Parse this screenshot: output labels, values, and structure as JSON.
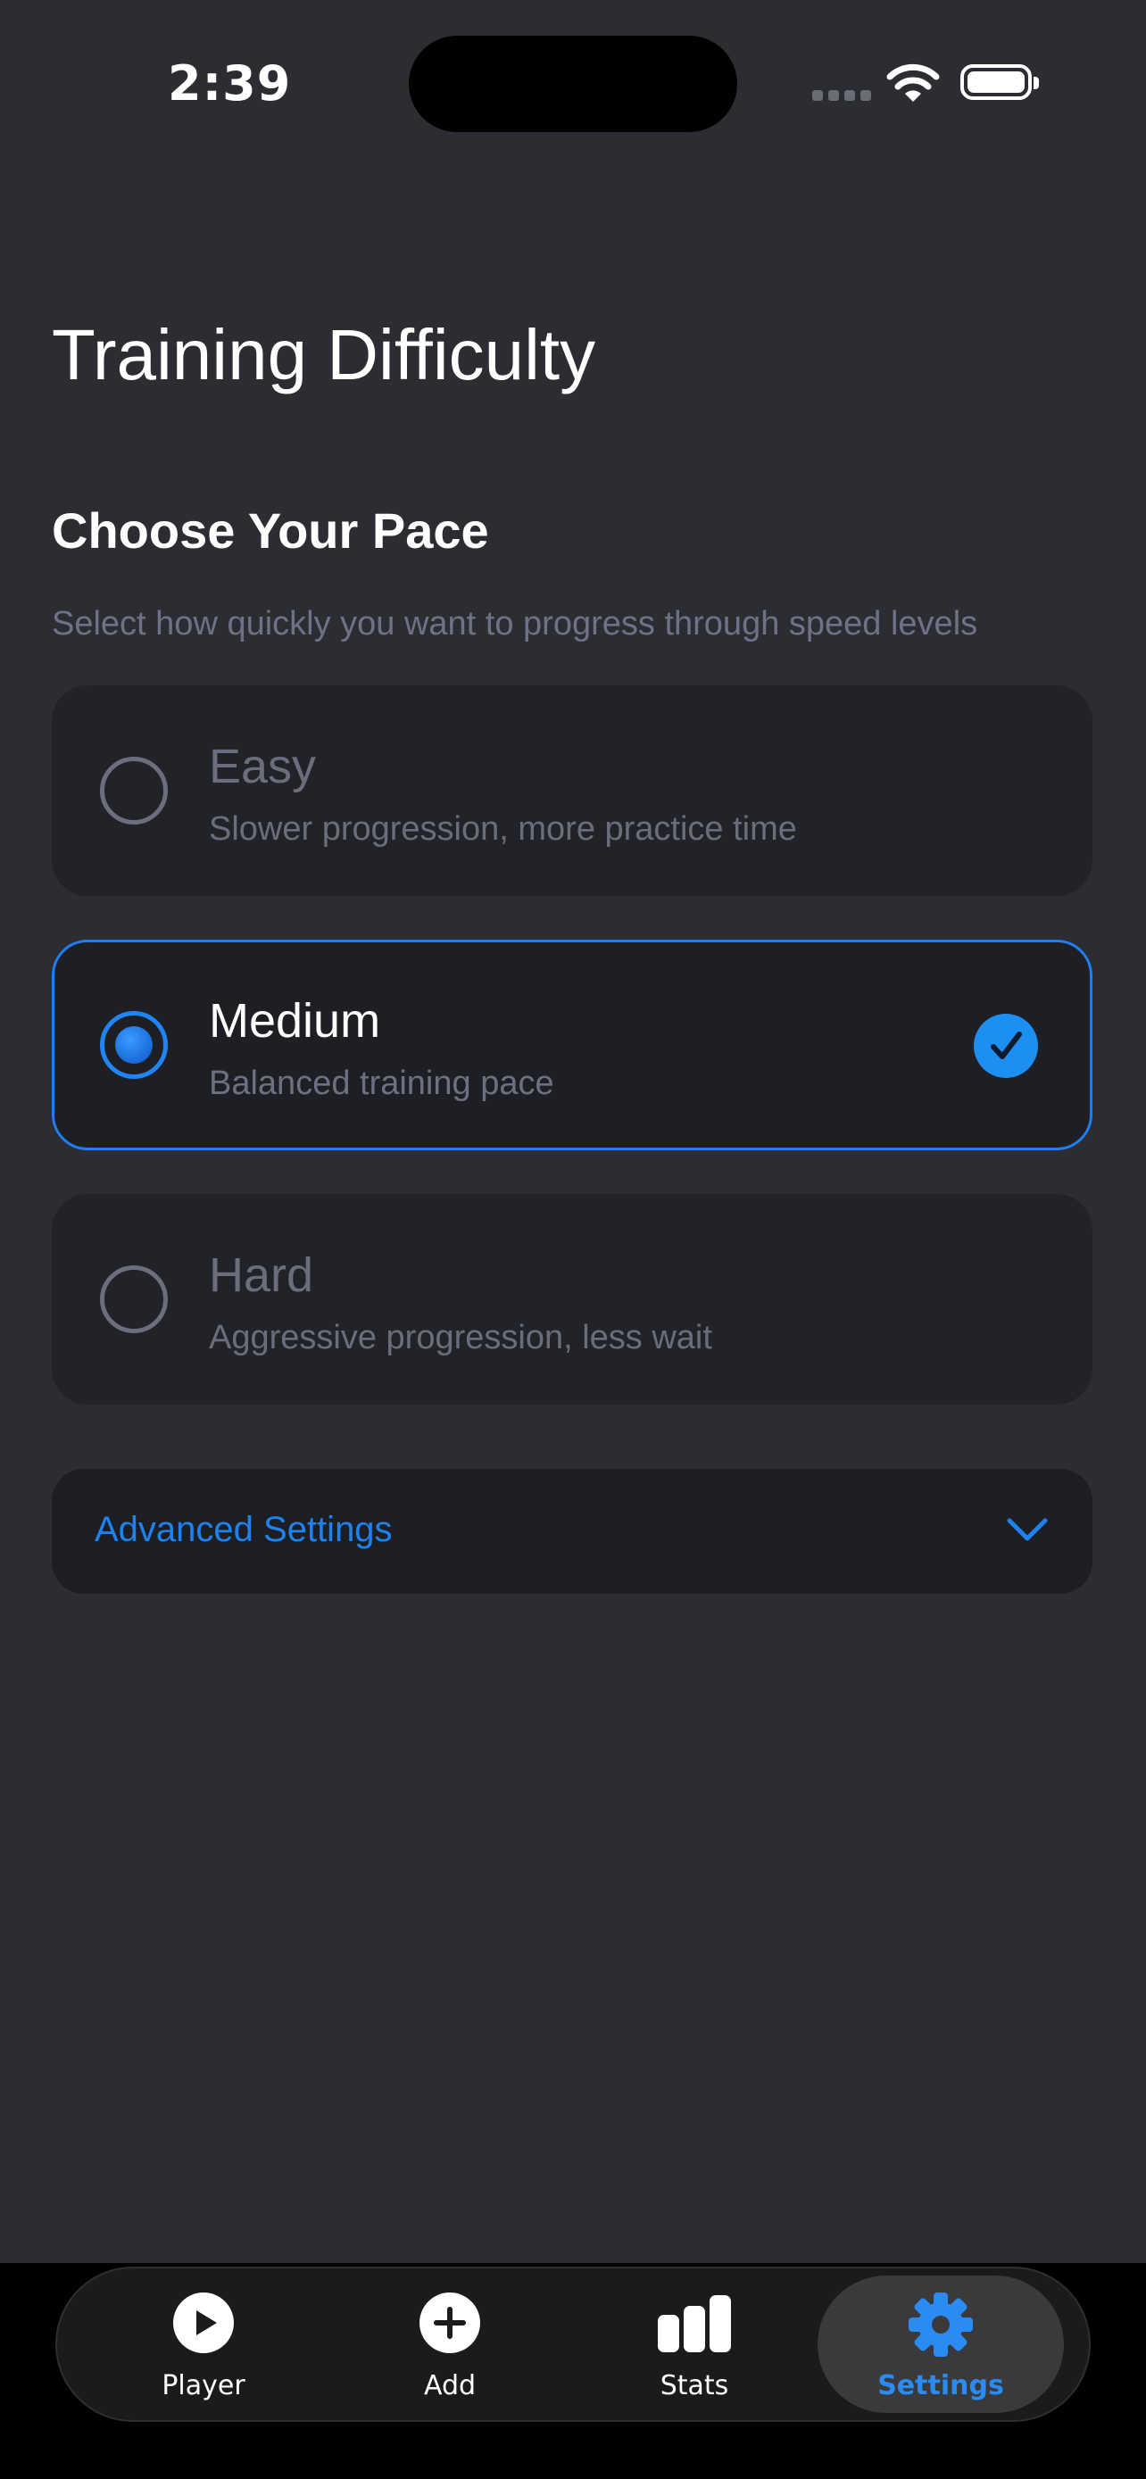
{
  "status_bar": {
    "time": "2:39"
  },
  "page_title": "Training Difficulty",
  "section_title": "Choose Your Pace",
  "subtitle": "Select how quickly you want to progress through speed levels",
  "options": [
    {
      "label": "Easy",
      "description": "Slower progression, more practice time",
      "selected": false
    },
    {
      "label": "Medium",
      "description": "Balanced training pace",
      "selected": true
    },
    {
      "label": "Hard",
      "description": "Aggressive progression, less wait",
      "selected": false
    }
  ],
  "advanced": {
    "label": "Advanced Settings",
    "icon": "chevron-down-icon"
  },
  "tabs": [
    {
      "label": "Player",
      "icon": "play-icon",
      "active": false
    },
    {
      "label": "Add",
      "icon": "plus-icon",
      "active": false
    },
    {
      "label": "Stats",
      "icon": "bar-chart-icon",
      "active": false
    },
    {
      "label": "Settings",
      "icon": "gear-icon",
      "active": true
    }
  ],
  "colors": {
    "accent": "#1f84f4",
    "background": "#2c2d32",
    "card": "#222328",
    "muted_text": "#6b6d7c"
  }
}
